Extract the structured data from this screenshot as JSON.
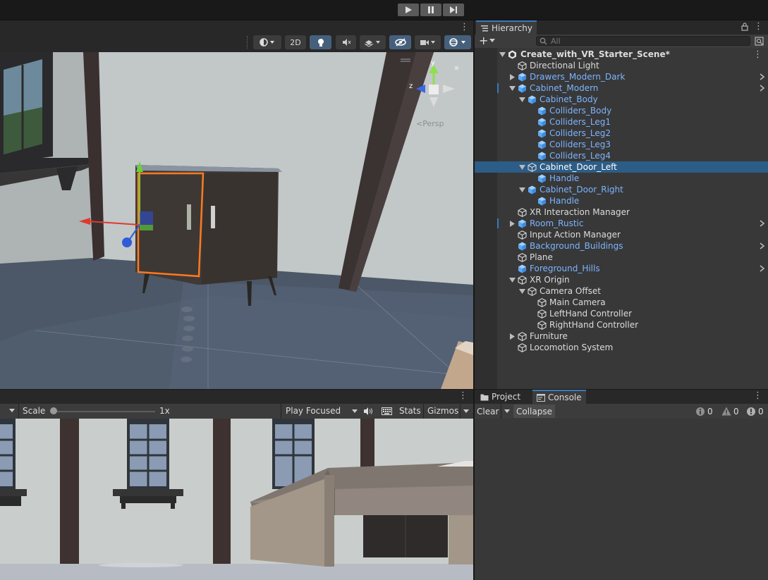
{
  "playbar": {
    "play": "play-icon",
    "pause": "pause-icon",
    "step": "step-icon"
  },
  "scene_toolbar": {
    "mode_2d": "2D",
    "icons": [
      "shading-mode-icon",
      "lighting-icon",
      "audio-icon",
      "effects-icon",
      "visibility-icon",
      "camera-icon",
      "gizmos-icon"
    ]
  },
  "scene_gizmo": {
    "y": "y",
    "z": "z",
    "projection": "<Persp"
  },
  "hierarchy": {
    "tab_label": "Hierarchy",
    "search_placeholder": "All",
    "scene_name": "Create_with_VR_Starter_Scene*",
    "items": [
      {
        "label": "Directional Light",
        "depth": 1,
        "prefab": false,
        "fold": "none",
        "chevron": false,
        "selected": false
      },
      {
        "label": "Drawers_Modern_Dark",
        "depth": 1,
        "prefab": true,
        "fold": "closed",
        "chevron": true,
        "selected": false
      },
      {
        "label": "Cabinet_Modern",
        "depth": 1,
        "prefab": true,
        "fold": "open",
        "chevron": true,
        "selected": false,
        "mark": true
      },
      {
        "label": "Cabinet_Body",
        "depth": 2,
        "prefab": true,
        "fold": "open",
        "chevron": false,
        "selected": false
      },
      {
        "label": "Colliders_Body",
        "depth": 3,
        "prefab": true,
        "fold": "none",
        "chevron": false,
        "selected": false
      },
      {
        "label": "Colliders_Leg1",
        "depth": 3,
        "prefab": true,
        "fold": "none",
        "chevron": false,
        "selected": false
      },
      {
        "label": "Colliders_Leg2",
        "depth": 3,
        "prefab": true,
        "fold": "none",
        "chevron": false,
        "selected": false
      },
      {
        "label": "Colliders_Leg3",
        "depth": 3,
        "prefab": true,
        "fold": "none",
        "chevron": false,
        "selected": false
      },
      {
        "label": "Colliders_Leg4",
        "depth": 3,
        "prefab": true,
        "fold": "none",
        "chevron": false,
        "selected": false
      },
      {
        "label": "Cabinet_Door_Left",
        "depth": 2,
        "prefab": false,
        "fold": "open",
        "chevron": false,
        "selected": true
      },
      {
        "label": "Handle",
        "depth": 3,
        "prefab": true,
        "fold": "none",
        "chevron": false,
        "selected": false
      },
      {
        "label": "Cabinet_Door_Right",
        "depth": 2,
        "prefab": true,
        "fold": "open",
        "chevron": false,
        "selected": false
      },
      {
        "label": "Handle",
        "depth": 3,
        "prefab": true,
        "fold": "none",
        "chevron": false,
        "selected": false
      },
      {
        "label": "XR Interaction Manager",
        "depth": 1,
        "prefab": false,
        "fold": "none",
        "chevron": false,
        "selected": false
      },
      {
        "label": "Room_Rustic",
        "depth": 1,
        "prefab": true,
        "fold": "closed",
        "chevron": true,
        "selected": false,
        "mark": true
      },
      {
        "label": "Input Action Manager",
        "depth": 1,
        "prefab": false,
        "fold": "none",
        "chevron": false,
        "selected": false
      },
      {
        "label": "Background_Buildings",
        "depth": 1,
        "prefab": true,
        "fold": "none",
        "chevron": true,
        "selected": false
      },
      {
        "label": "Plane",
        "depth": 1,
        "prefab": false,
        "fold": "none",
        "chevron": false,
        "selected": false
      },
      {
        "label": "Foreground_Hills",
        "depth": 1,
        "prefab": true,
        "fold": "none",
        "chevron": true,
        "selected": false
      },
      {
        "label": "XR Origin",
        "depth": 1,
        "prefab": false,
        "fold": "open",
        "chevron": false,
        "selected": false
      },
      {
        "label": "Camera Offset",
        "depth": 2,
        "prefab": false,
        "fold": "open",
        "chevron": false,
        "selected": false
      },
      {
        "label": "Main Camera",
        "depth": 3,
        "prefab": false,
        "fold": "none",
        "chevron": false,
        "selected": false
      },
      {
        "label": "LeftHand Controller",
        "depth": 3,
        "prefab": false,
        "fold": "none",
        "chevron": false,
        "selected": false
      },
      {
        "label": "RightHand Controller",
        "depth": 3,
        "prefab": false,
        "fold": "none",
        "chevron": false,
        "selected": false
      },
      {
        "label": "Furniture",
        "depth": 1,
        "prefab": false,
        "fold": "closed",
        "chevron": false,
        "selected": false
      },
      {
        "label": "Locomotion System",
        "depth": 1,
        "prefab": false,
        "fold": "none",
        "chevron": false,
        "selected": false
      }
    ]
  },
  "game_toolbar": {
    "scale_label": "Scale",
    "scale_value": "1x",
    "scale_fraction": 0.0,
    "play_mode": "Play Focused",
    "stats": "Stats",
    "gizmos": "Gizmos"
  },
  "console": {
    "tab_project": "Project",
    "tab_console": "Console",
    "clear": "Clear",
    "collapse": "Collapse",
    "info_count": "0",
    "warning_count": "0",
    "error_count": "0"
  },
  "colors": {
    "selection": "#2c5d87",
    "prefab_text": "#7cb4ff",
    "panel": "#383838",
    "accent": "#3a79bb"
  }
}
